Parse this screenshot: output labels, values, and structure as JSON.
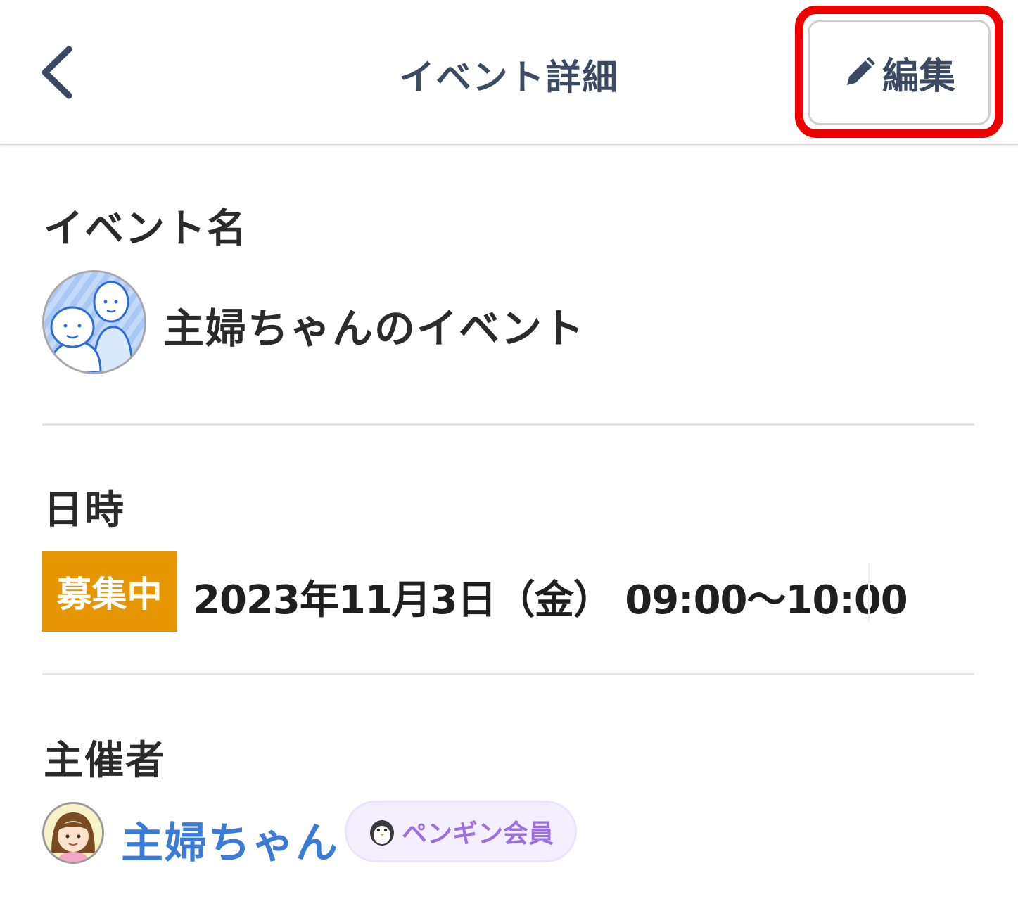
{
  "header": {
    "title": "イベント詳細",
    "back_icon": "chevron-left-icon",
    "edit": {
      "icon": "pencil-icon",
      "label": "編集"
    }
  },
  "event_name": {
    "label": "イベント名",
    "value": "主婦ちゃんのイベント"
  },
  "datetime": {
    "label": "日時",
    "status": "募集中",
    "value": "2023年11月3日（金） 09:00〜10:00"
  },
  "organizer": {
    "label": "主催者",
    "name": "主婦ちゃん",
    "membership": {
      "icon": "penguin-icon",
      "label": "ペンギン会員"
    }
  },
  "colors": {
    "header_text": "#3a4a63",
    "highlight": "#ee0000",
    "status_badge": "#e59600",
    "organizer_link": "#3a7bd5",
    "member_badge_text": "#9b6fe0"
  }
}
